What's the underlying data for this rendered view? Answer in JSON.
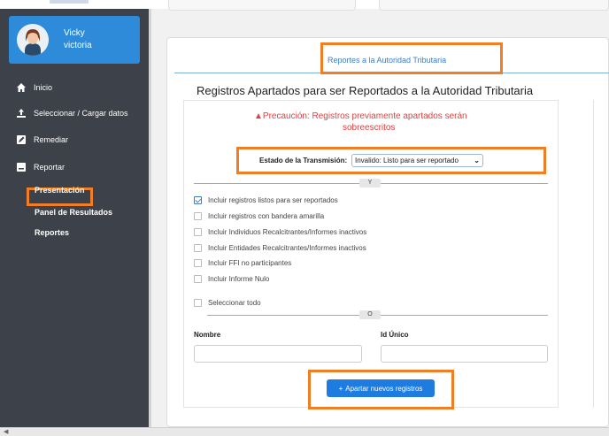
{
  "sidebar": {
    "user": {
      "first_name": "Vicky",
      "last_name": "victoria"
    },
    "items": [
      {
        "label": "Inicio",
        "icon": "home-icon"
      },
      {
        "label": "Seleccionar / Cargar datos",
        "icon": "upload-icon"
      },
      {
        "label": "Remediar",
        "icon": "edit-icon"
      },
      {
        "label": "Reportar",
        "icon": "report-icon"
      }
    ],
    "sub_items": [
      {
        "label": "Presentación",
        "highlighted": true
      },
      {
        "label": "Panel de Resultados"
      },
      {
        "label": "Reportes"
      }
    ]
  },
  "tab": {
    "label": "Reportes a la Autoridad Tributaria"
  },
  "page": {
    "title": "Registros Apartados para ser Reportados a la Autoridad Tributaria",
    "warning_line1": "Precaución: Registros previamente apartados serán",
    "warning_line2": "sobreescritos"
  },
  "status": {
    "label": "Estado de la Transmisión:",
    "selected": "Invalido: Listo para ser reportado"
  },
  "dividers": {
    "and": "Y",
    "or": "O"
  },
  "checkboxes": [
    {
      "label": "Incluir registros listos para ser reportados",
      "checked": true
    },
    {
      "label": "Incluir registros con bandera amarilla",
      "checked": false
    },
    {
      "label": "Incluir Individuos Recalcitrantes/Informes inactivos",
      "checked": false
    },
    {
      "label": "Incluir Entidades Recalcitrantes/Informes inactivos",
      "checked": false
    },
    {
      "label": "Incluir FFI no participantes",
      "checked": false
    },
    {
      "label": "Incluir Informe Nulo",
      "checked": false
    }
  ],
  "select_all": {
    "label": "Seleccionar todo",
    "checked": false
  },
  "fields": {
    "name_label": "Nombre",
    "id_label": "Id Único"
  },
  "actions": {
    "primary_label": "Apartar nuevos registros"
  },
  "colors": {
    "accent": "#1e7be0",
    "highlight": "#f07e25",
    "sidebar": "#3d4149",
    "warning": "#e04040"
  }
}
